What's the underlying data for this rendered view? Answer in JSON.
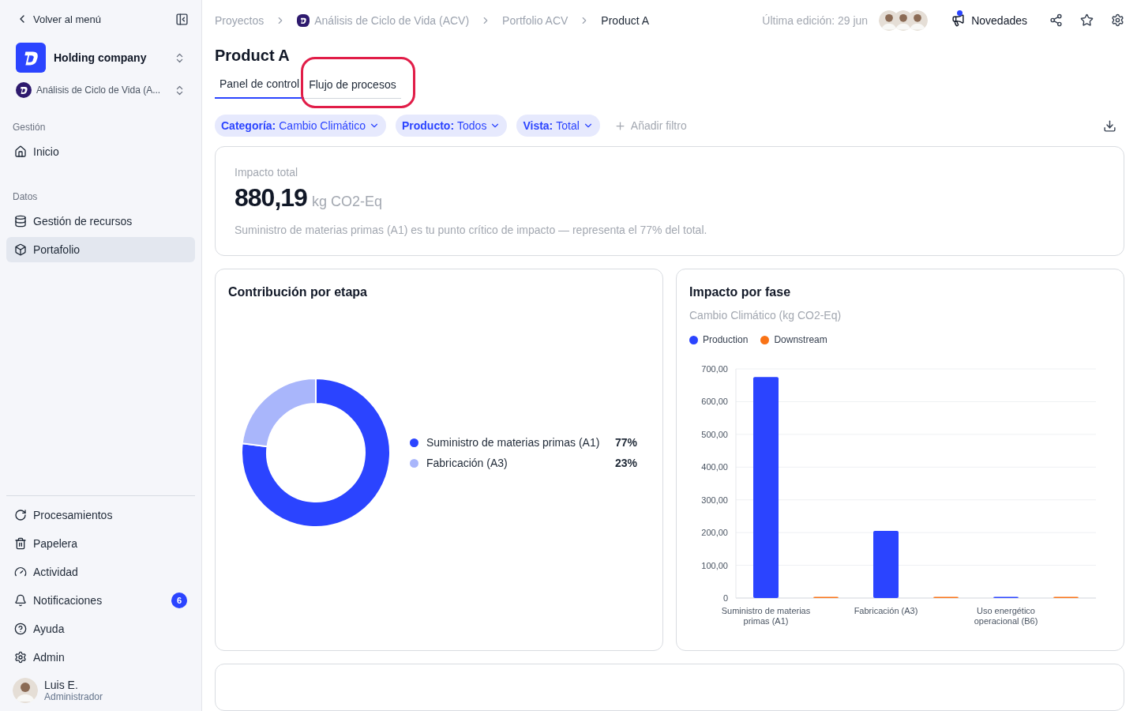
{
  "sidebar": {
    "back": "Volver al menú",
    "company": "Holding company",
    "project": "Análisis de Ciclo de Vida (A...",
    "sections": [
      {
        "title": "Gestión",
        "items": [
          {
            "label": "Inicio",
            "selected": false
          }
        ]
      },
      {
        "title": "Datos",
        "items": [
          {
            "label": "Gestión de recursos",
            "selected": false
          },
          {
            "label": "Portafolio",
            "selected": true
          }
        ]
      }
    ],
    "bottom_items": [
      {
        "label": "Procesamientos"
      },
      {
        "label": "Papelera"
      },
      {
        "label": "Actividad"
      },
      {
        "label": "Notificaciones",
        "badge": "6"
      },
      {
        "label": "Ayuda"
      },
      {
        "label": "Admin"
      }
    ],
    "user": {
      "name": "Luis E.",
      "role": "Administrador"
    }
  },
  "breadcrumbs": [
    {
      "label": "Proyectos",
      "logo": false
    },
    {
      "label": "Análisis de Ciclo de Vida (ACV)",
      "logo": true
    },
    {
      "label": "Portfolio ACV",
      "logo": false
    },
    {
      "label": "Product A",
      "logo": false
    }
  ],
  "last_edit": "Última edición: 29 jun",
  "news": {
    "label": "Novedades",
    "unread": true
  },
  "title": "Product A",
  "tabs": [
    {
      "label": "Panel de control",
      "selected": true
    },
    {
      "label": "Flujo de procesos",
      "selected": false,
      "highlighted": true
    }
  ],
  "filters": [
    {
      "key": "Categoría:",
      "value": "Cambio Climático"
    },
    {
      "key": "Producto:",
      "value": "Todos"
    },
    {
      "key": "Vista:",
      "value": "Total"
    }
  ],
  "add_filter": "Añadir filtro",
  "total": {
    "label": "Impacto total",
    "value": "880,19",
    "unit": "kg CO2-Eq",
    "note": "Suministro de materias primas (A1) es tu punto crítico de impacto — representa el 77% del total."
  },
  "stage_card": {
    "title": "Contribución por etapa",
    "chart_data": {
      "type": "donut",
      "categories": [
        "Suministro de materias primas (A1)",
        "Fabricación (A3)"
      ],
      "values": [
        77,
        23
      ],
      "value_labels": [
        "77%",
        "23%"
      ]
    }
  },
  "phase_card": {
    "title": "Impacto por fase",
    "chart_data": {
      "type": "bar",
      "title": "Cambio Climático (kg CO2-Eq)",
      "categories": [
        "Suministro de materias primas (A1)",
        "Fabricación (A3)",
        "Uso energético operacional (B6)"
      ],
      "series": [
        {
          "name": "Production",
          "color": "#2b44ff",
          "values": [
            675,
            205,
            0
          ]
        },
        {
          "name": "Downstream",
          "color": "#f97316",
          "values": [
            1,
            1,
            1
          ]
        }
      ],
      "grid": true,
      "ylim": [
        0,
        700
      ],
      "yticks": [
        {
          "value": 0,
          "label": "0"
        },
        {
          "value": 100,
          "label": "100,00"
        },
        {
          "value": 200,
          "label": "200,00"
        },
        {
          "value": 300,
          "label": "300,00"
        },
        {
          "value": 400,
          "label": "400,00"
        },
        {
          "value": 500,
          "label": "500,00"
        },
        {
          "value": 600,
          "label": "600,00"
        },
        {
          "value": 700,
          "label": "700,00"
        }
      ]
    }
  }
}
